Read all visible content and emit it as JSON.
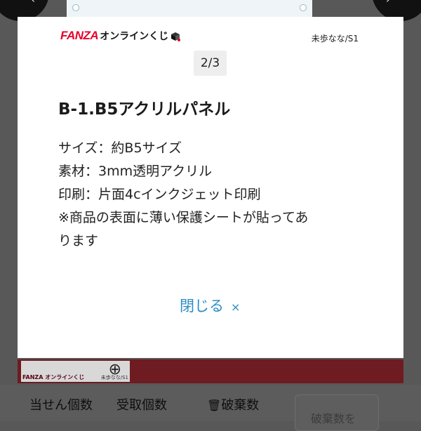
{
  "modal": {
    "brand": {
      "fanza": "FANZA",
      "service": "オンラインくじ"
    },
    "author": "未歩なな/S1",
    "page_indicator": "2/3",
    "title": "B-1.B5アクリルパネル",
    "description": [
      "サイズ：約B5サイズ",
      "素材：3mm透明アクリル",
      "印刷：片面4cインクジェット印刷",
      "※商品の表面に薄い保護シートが貼ってあ",
      "ります"
    ],
    "close_label": "閉じる",
    "close_icon": "×"
  },
  "background": {
    "card_logo": "FANZA オンラインくじ",
    "card_author": "未歩なな/S1",
    "footer_tabs": [
      "当せん個数",
      "受取個数",
      "破棄数"
    ],
    "footer_button": "破棄数を"
  },
  "colors": {
    "brand_red": "#e6002d",
    "link_blue": "#2c8ec4",
    "overlay": "#585858"
  }
}
